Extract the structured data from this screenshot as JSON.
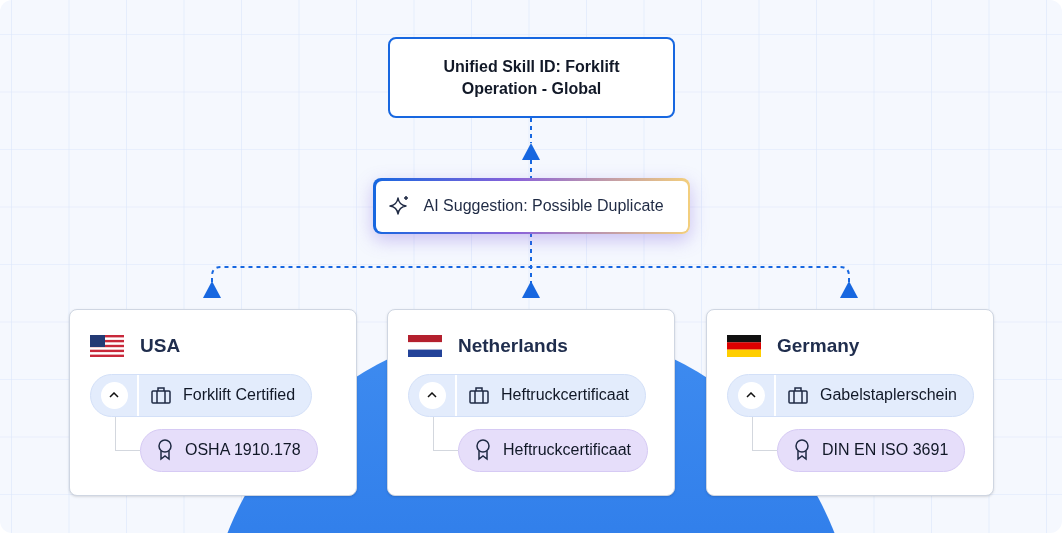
{
  "unified_node": {
    "title": "Unified Skill ID: Forklift Operation - Global"
  },
  "ai_suggestion": {
    "label": "AI Suggestion: Possible Duplicate"
  },
  "countries": [
    {
      "name": "USA",
      "kind": "us",
      "skill": {
        "label": "Forklift Certified",
        "expanded": true,
        "certification": "OSHA 1910.178"
      }
    },
    {
      "name": "Netherlands",
      "kind": "nl",
      "skill": {
        "label": "Heftruckcertificaat",
        "expanded": true,
        "certification": "Heftruckcertificaat"
      }
    },
    {
      "name": "Germany",
      "kind": "de",
      "skill": {
        "label": "Gabelstaplerschein",
        "expanded": true,
        "certification": "DIN EN ISO 3691"
      }
    }
  ]
}
